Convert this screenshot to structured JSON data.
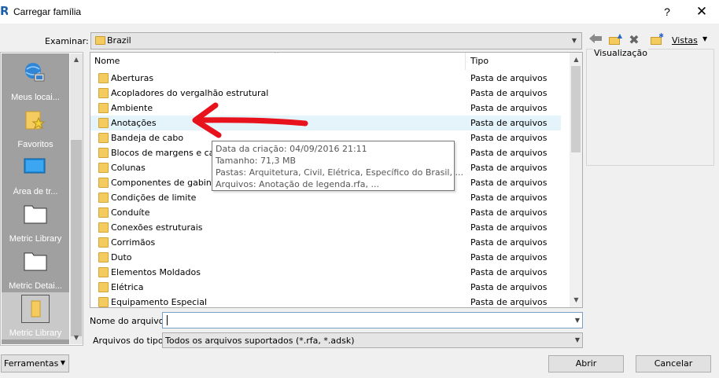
{
  "window": {
    "title": "Carregar família",
    "help": "?",
    "close": "✕",
    "logo": "R"
  },
  "lookin": {
    "label": "Examinar:",
    "value": "Brazil"
  },
  "toolbar": {
    "views_label": "Vistas"
  },
  "places": [
    {
      "label": "Meus locai...",
      "icon": "my-places-icon"
    },
    {
      "label": "Favoritos",
      "icon": "favorites-icon"
    },
    {
      "label": "Área de tr...",
      "icon": "desktop-icon"
    },
    {
      "label": "Metric Library",
      "icon": "folder-icon"
    },
    {
      "label": "Metric Detai...",
      "icon": "folder-icon"
    },
    {
      "label": "Metric Library",
      "icon": "folder-icon"
    }
  ],
  "list": {
    "col_name": "Nome",
    "col_type": "Tipo",
    "rows": [
      {
        "name": "Aberturas",
        "type": "Pasta de arquivos"
      },
      {
        "name": "Acopladores do vergalhão estrutural",
        "type": "Pasta de arquivos"
      },
      {
        "name": "Ambiente",
        "type": "Pasta de arquivos"
      },
      {
        "name": "Anotações",
        "type": "Pasta de arquivos"
      },
      {
        "name": "Bandeja de cabo",
        "type": "Pasta de arquivos"
      },
      {
        "name": "Blocos de margens e car",
        "type": "Pasta de arquivos"
      },
      {
        "name": "Colunas",
        "type": "Pasta de arquivos"
      },
      {
        "name": "Componentes de gabine",
        "type": "Pasta de arquivos"
      },
      {
        "name": "Condições de limite",
        "type": "Pasta de arquivos"
      },
      {
        "name": "Conduíte",
        "type": "Pasta de arquivos"
      },
      {
        "name": "Conexões estruturais",
        "type": "Pasta de arquivos"
      },
      {
        "name": "Corrimãos",
        "type": "Pasta de arquivos"
      },
      {
        "name": "Duto",
        "type": "Pasta de arquivos"
      },
      {
        "name": "Elementos Moldados",
        "type": "Pasta de arquivos"
      },
      {
        "name": "Elétrica",
        "type": "Pasta de arquivos"
      },
      {
        "name": "Equipamento Especial",
        "type": "Pasta de arquivos"
      }
    ]
  },
  "tooltip": {
    "line1": "Data da criação: 04/09/2016 21:11",
    "line2": "Tamanho: 71,3 MB",
    "line3": "Pastas: Arquitetura, Civil, Elétrica, Específico do Brasil, ...",
    "line4": "Arquivos: Anotação de legenda.rfa, ..."
  },
  "preview": {
    "label": "Visualização"
  },
  "filename": {
    "label": "Nome do arquivo:",
    "value": ""
  },
  "filetype": {
    "label": "Arquivos do tipo:",
    "value": "Todos os arquivos suportados  (*.rfa, *.adsk)"
  },
  "buttons": {
    "tools": "Ferramentas",
    "open": "Abrir",
    "cancel": "Cancelar"
  },
  "colors": {
    "highlight_row": "#e5f3fb",
    "annotation_arrow": "#e8121c",
    "folder": "#f3cb5f"
  }
}
